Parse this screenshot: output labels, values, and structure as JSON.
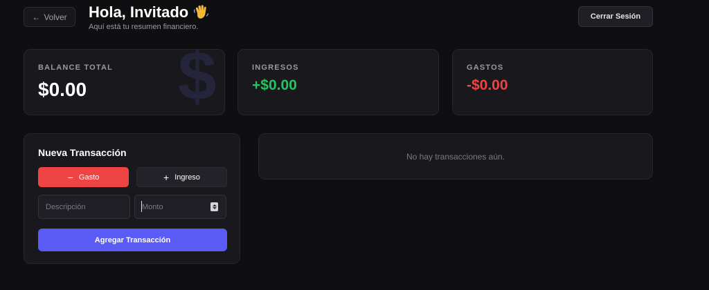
{
  "header": {
    "back_label": "Volver",
    "greeting": "Hola, Invitado",
    "subtitle": "Aquí está tu resumen financiero.",
    "logout_label": "Cerrar Sesión"
  },
  "stats": {
    "balance": {
      "label": "BALANCE TOTAL",
      "value": "$0.00"
    },
    "income": {
      "label": "INGRESOS",
      "value": "+$0.00",
      "color": "#22c55e"
    },
    "expenses": {
      "label": "GASTOS",
      "value": "-$0.00",
      "color": "#ef4444"
    }
  },
  "form": {
    "title": "Nueva Transacción",
    "expense_label": "Gasto",
    "income_label": "Ingreso",
    "description_placeholder": "Descripción",
    "amount_placeholder": "Monto",
    "submit_label": "Agregar Transacción",
    "accent_color": "#5b5bf6",
    "expense_color": "#ef4444"
  },
  "transactions": {
    "empty_message": "No hay transacciones aún.",
    "items": []
  }
}
